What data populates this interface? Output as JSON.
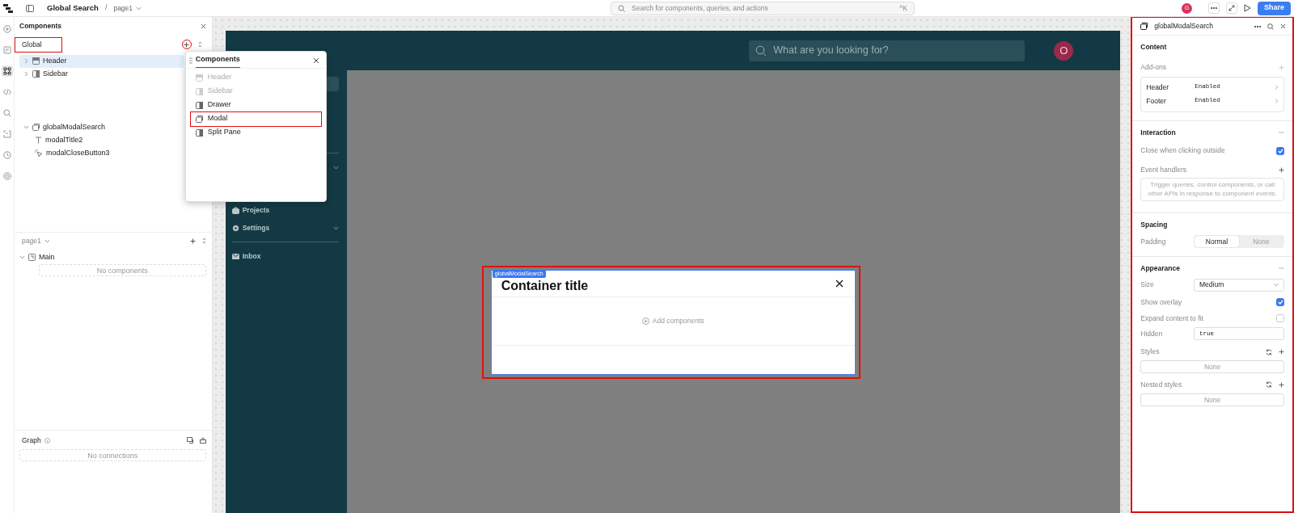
{
  "topbar": {
    "app_title": "Global Search",
    "separator": "/",
    "page": "page1",
    "search_placeholder": "Search for components, queries, and actions",
    "shortcut": "^K",
    "avatar": "G",
    "share": "Share"
  },
  "rail": [
    {
      "kind": "add",
      "selected": false
    },
    {
      "kind": "notes",
      "selected": false
    },
    {
      "kind": "components",
      "selected": true
    },
    {
      "kind": "code",
      "selected": false
    },
    {
      "kind": "search",
      "selected": false
    },
    {
      "kind": "state",
      "selected": false
    },
    {
      "kind": "history",
      "selected": false
    },
    {
      "kind": "settings",
      "selected": false
    }
  ],
  "components_panel": {
    "title": "Components",
    "scope": "Global",
    "scope_highlighted": true,
    "add_highlighted": true,
    "global_items": [
      {
        "label": "Header",
        "kind": "header",
        "selected": true,
        "expanded": false
      },
      {
        "label": "Sidebar",
        "kind": "sidebar",
        "selected": false,
        "expanded": false
      }
    ],
    "tree": [
      {
        "label": "globalModalSearch",
        "kind": "modal",
        "expanded": true,
        "children": [
          {
            "label": "modalTitle2",
            "kind": "text"
          },
          {
            "label": "modalCloseButton3",
            "kind": "button"
          }
        ]
      }
    ]
  },
  "page_panel": {
    "page": "page1",
    "frame": {
      "label": "Main",
      "expanded": true
    },
    "empty": "No components"
  },
  "graph": {
    "title": "Graph",
    "empty": "No connections"
  },
  "popup": {
    "title": "Components",
    "items": [
      {
        "label": "Header",
        "kind": "header",
        "disabled": true,
        "highlighted": false
      },
      {
        "label": "Sidebar",
        "kind": "sidebar",
        "disabled": true,
        "highlighted": false
      },
      {
        "label": "Drawer",
        "kind": "sidebar",
        "disabled": false,
        "highlighted": false
      },
      {
        "label": "Modal",
        "kind": "modal",
        "disabled": false,
        "highlighted": true
      },
      {
        "label": "Split Pane",
        "kind": "sidebar",
        "disabled": false,
        "highlighted": false
      }
    ]
  },
  "canvas": {
    "search_placeholder": "What are you looking for?",
    "avatar": "O",
    "nav": [
      {
        "kind": "active"
      },
      {
        "kind": "divider"
      },
      {
        "kind": "group",
        "expandable": true
      },
      {
        "kind": "briefcase",
        "label": "Projects",
        "expandable": false
      },
      {
        "kind": "gear",
        "label": "Settings",
        "expandable": true
      },
      {
        "kind": "divider"
      },
      {
        "kind": "mail",
        "label": "Inbox",
        "expandable": false
      }
    ],
    "modal": {
      "tag": "globalModalSearch",
      "title": "Container title",
      "action": "Add components",
      "highlighted": true
    }
  },
  "inspector": {
    "title": "globalModalSearch",
    "highlighted": true,
    "content": {
      "heading": "Content",
      "addons_label": "Add-ons",
      "addons": [
        {
          "name": "Header",
          "value": "Enabled"
        },
        {
          "name": "Footer",
          "value": "Enabled"
        }
      ]
    },
    "interaction": {
      "heading": "Interaction",
      "close_outside": {
        "label": "Close when clicking outside",
        "checked": true
      },
      "event_label": "Event handlers",
      "event_hint": "Trigger queries, control components, or call other APIs in response to component events."
    },
    "spacing": {
      "heading": "Spacing",
      "label": "Padding",
      "options": [
        {
          "label": "Normal",
          "selected": true
        },
        {
          "label": "None",
          "selected": false
        }
      ]
    },
    "appearance": {
      "heading": "Appearance",
      "size_label": "Size",
      "size_value": "Medium",
      "toggles": [
        {
          "label": "Show overlay",
          "checked": true
        },
        {
          "label": "Expand content to fit",
          "checked": false
        }
      ],
      "hidden_label": "Hidden",
      "hidden_value": "true",
      "styles_label": "Styles",
      "styles_value": "None",
      "nested_label": "Nested styles",
      "nested_value": "None"
    }
  }
}
